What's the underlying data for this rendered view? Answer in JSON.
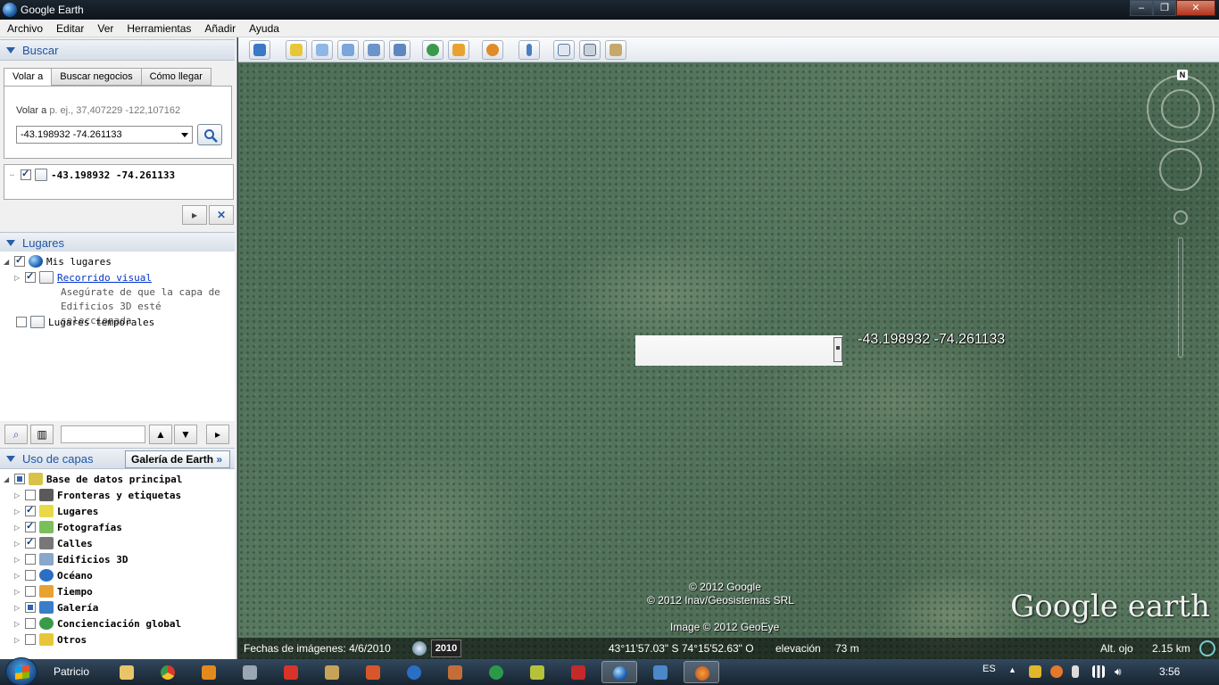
{
  "window": {
    "title": "Google Earth",
    "min": "–",
    "max": "❐",
    "close": "✕"
  },
  "menu": [
    "Archivo",
    "Editar",
    "Ver",
    "Herramientas",
    "Añadir",
    "Ayuda"
  ],
  "search": {
    "header": "Buscar",
    "tabs": [
      "Volar a",
      "Buscar negocios",
      "Cómo llegar"
    ],
    "fly_label": "Volar a",
    "fly_placeholder": "p. ej., 37,407229 -122,107162",
    "fly_value": "-43.198932 -74.261133",
    "result": "-43.198932 -74.261133"
  },
  "places": {
    "header": "Lugares",
    "my_places": "Mis lugares",
    "tour_link": "Recorrido visual",
    "tour_note_1": "Asegúrate de que la capa de",
    "tour_note_2": "Edificios 3D esté seleccionada",
    "temp_places": "Lugares temporales"
  },
  "layers": {
    "header": "Uso de capas",
    "gallery_button": "Galería de Earth",
    "gallery_arrow": "»",
    "items": [
      {
        "label": "Base de datos principal",
        "checked": "part",
        "icon": "layers-icon"
      },
      {
        "label": "Fronteras y etiquetas",
        "checked": "off",
        "icon": "flag-icon"
      },
      {
        "label": "Lugares",
        "checked": "on",
        "icon": "place-icon"
      },
      {
        "label": "Fotografías",
        "checked": "on",
        "icon": "photo-icon"
      },
      {
        "label": "Calles",
        "checked": "on",
        "icon": "road-icon"
      },
      {
        "label": "Edificios 3D",
        "checked": "off",
        "icon": "building-icon"
      },
      {
        "label": "Océano",
        "checked": "off",
        "icon": "ocean-icon"
      },
      {
        "label": "Tiempo",
        "checked": "off",
        "icon": "weather-icon"
      },
      {
        "label": "Galería",
        "checked": "part",
        "icon": "gallery-star-icon"
      },
      {
        "label": "Concienciación global",
        "checked": "off",
        "icon": "globe-icon"
      },
      {
        "label": "Otros",
        "checked": "off",
        "icon": "other-icon"
      }
    ]
  },
  "map": {
    "placemark_label": "-43.198932 -74.261133",
    "north": "N",
    "credit_1": "© 2012 Google",
    "credit_2": "© 2012 Inav/Geosistemas SRL",
    "credit_3": "Image © 2012 GeoEye",
    "logo": "Google earth"
  },
  "status": {
    "imagery_date": "Fechas de imágenes: 4/6/2010",
    "year": "2010",
    "coords": "43°11'57.03\" S   74°15'52.63\" O",
    "elevation_label": "elevación",
    "elevation_value": "73 m",
    "eye_label": "Alt. ojo",
    "eye_value": "2.15 km"
  },
  "taskbar": {
    "user": "Patricio",
    "lang": "ES",
    "time": "3:56"
  }
}
